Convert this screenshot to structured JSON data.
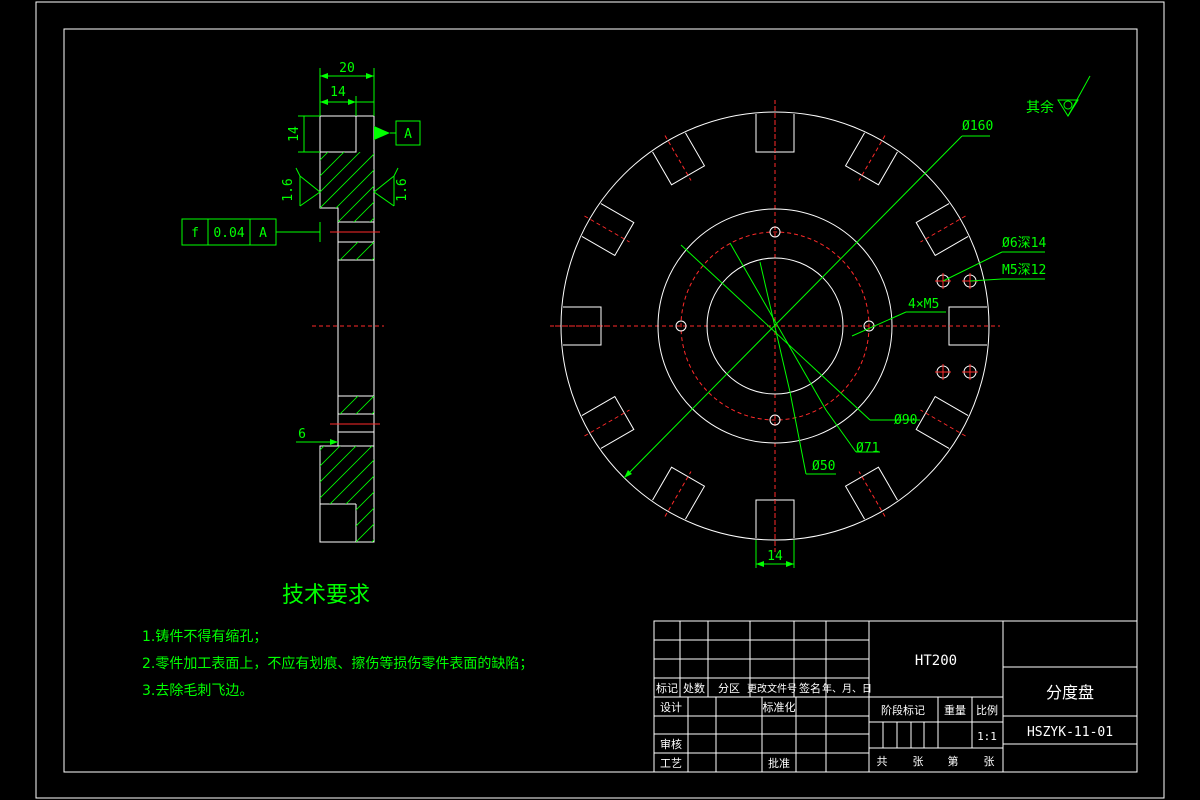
{
  "colors": {
    "background": "#000000",
    "outline": "#ffffff",
    "annotation": "#00ff00",
    "centerline": "#ff2a2a"
  },
  "section_view": {
    "dim_overall_width": "20",
    "dim_bore_width": "14",
    "dim_height": "14",
    "datum_label": "A",
    "roughness_left": "1.6",
    "roughness_right": "1.6",
    "tolerance_symbol": "f",
    "tolerance_value": "0.04",
    "tolerance_datum": "A",
    "dim_bottom_offset": "6"
  },
  "front_view": {
    "dia_outer": "Ø160",
    "hole_callout_1": "Ø6深14",
    "hole_callout_2": "M5深12",
    "bolt_holes": "4×M5",
    "dia_90": "Ø90",
    "dia_71": "Ø71",
    "dia_50": "Ø50",
    "slot_width": "14",
    "surface_note": "其余"
  },
  "tech_requirements": {
    "title": "技术要求",
    "items": [
      "1.铸件不得有缩孔；",
      "2.零件加工表面上，不应有划痕、擦伤等损伤零件表面的缺陷；",
      "3.去除毛刺飞边。"
    ]
  },
  "title_block": {
    "material": "HT200",
    "part_name": "分度盘",
    "drawing_number": "HSZYK-11-01",
    "scale": "1:1",
    "label_mark": "标记",
    "label_count": "处数",
    "label_zone": "分区",
    "label_change_doc": "更改文件号",
    "label_sign": "签名",
    "label_date": "年、月、日",
    "label_design": "设计",
    "label_standardize": "标准化",
    "label_stage": "阶段标记",
    "label_weight": "重量",
    "label_scale": "比例",
    "label_review": "审核",
    "label_process": "工艺",
    "label_approve": "批准",
    "label_total": "共",
    "label_sheets": "张",
    "label_sheet_no": "第",
    "label_sheet_unit": "张"
  }
}
